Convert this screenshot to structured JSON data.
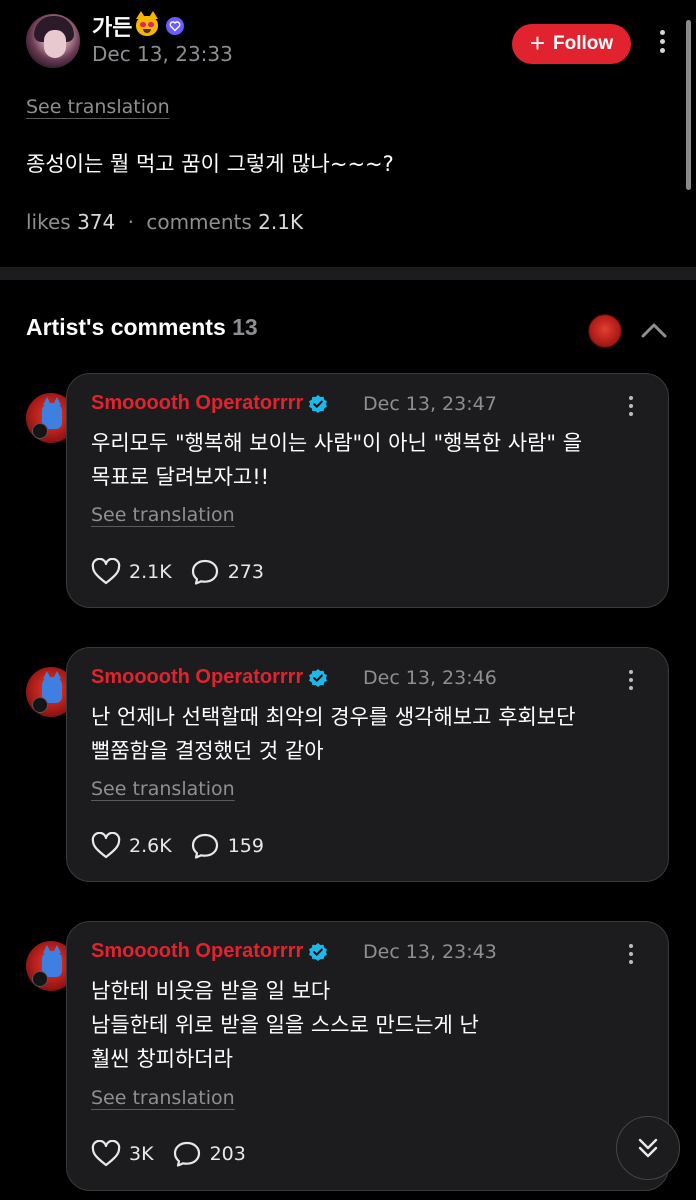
{
  "post": {
    "author": "가든",
    "date": "Dec 13, 23:33",
    "follow_label": "Follow",
    "see_translation": "See translation",
    "body": "종성이는 뭘 먹고 꿈이 그렇게 많나~~~?",
    "likes_label": "likes",
    "likes_value": "374",
    "comments_label": "comments",
    "comments_value": "2.1K"
  },
  "artist_comments": {
    "title": "Artist's comments",
    "count": "13",
    "items": [
      {
        "author": "Smooooth Operatorrrr",
        "date": "Dec 13, 23:47",
        "lines": [
          "우리모두 \"행복해 보이는 사람\"이 아닌 \"행복한 사람\" 을",
          "목표로 달려보자고!!"
        ],
        "see_translation": "See translation",
        "likes": "2.1K",
        "replies": "273"
      },
      {
        "author": "Smooooth Operatorrrr",
        "date": "Dec 13, 23:46",
        "lines": [
          "난 언제나 선택할때 최악의 경우를 생각해보고 후회보단",
          "뻘쭘함을 결정했던 것 같아"
        ],
        "see_translation": "See translation",
        "likes": "2.6K",
        "replies": "159"
      },
      {
        "author": "Smooooth Operatorrrr",
        "date": "Dec 13, 23:43",
        "lines": [
          "남한테 비웃음 받을 일 보다",
          "남들한테 위로 받을 일을 스스로 만드는게 난",
          "훨씬 창피하더라"
        ],
        "see_translation": "See translation",
        "likes": "3K",
        "replies": "203"
      }
    ]
  },
  "icons": {
    "follow": "plus-icon",
    "like": "heart-icon",
    "reply": "chat-bubble-icon",
    "verified": "verified-badge-icon",
    "more": "more-vertical-icon",
    "collapse": "chevron-up-icon",
    "scroll": "double-chevron-down-icon"
  },
  "colors": {
    "accent_red": "#e1232f",
    "verified_cyan": "#1db8e8",
    "card_bg": "#1c1c1e",
    "muted_text": "#8e8e93"
  }
}
